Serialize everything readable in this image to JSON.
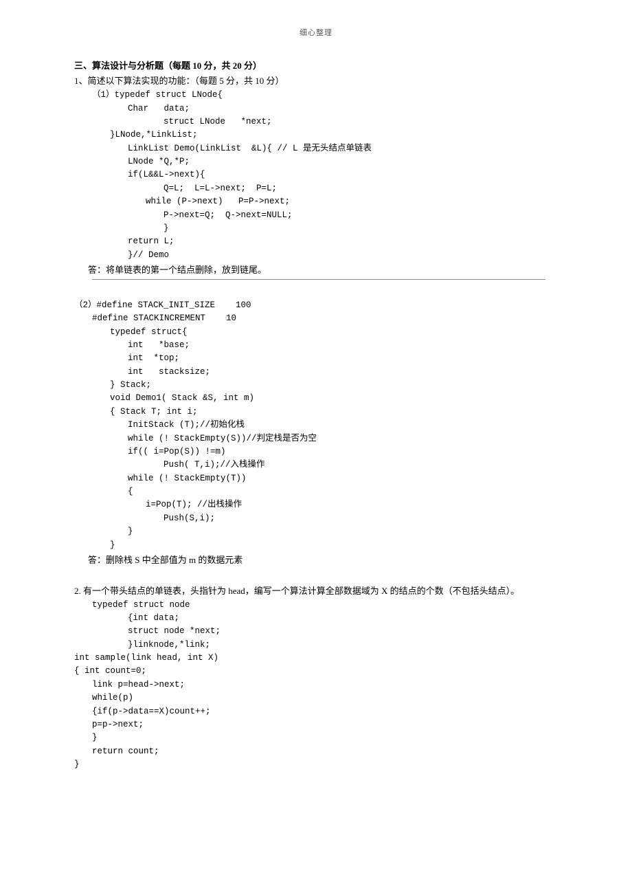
{
  "header": "细心整理",
  "sectionTitle": "三、算法设计与分析题（每题 10 分，共 20 分）",
  "q1": {
    "prompt": "1、简述以下算法实现的功能：（每题 5 分，共 10 分）",
    "sub1label": "（1）typedef struct LNode{",
    "code1": {
      "l1": "Char   data;",
      "l2": "struct LNode   *next;",
      "l3": "}LNode,*LinkList;",
      "l4": "LinkList Demo(LinkList  &L){ // L 是无头结点单链表",
      "l5": "LNode *Q,*P;",
      "l6": "if(L&&L->next){",
      "l7": "Q=L;  L=L->next;  P=L;",
      "l8": "while (P->next)   P=P->next;",
      "l9": "P->next=Q;  Q->next=NULL;",
      "l10": "}",
      "l11": "return L;",
      "l12": "}// Demo"
    },
    "answer1": "答：将单链表的第一个结点删除，放到链尾。",
    "sub2label": "（2）#define STACK_INIT_SIZE    100",
    "code2": {
      "l1": "#define STACKINCREMENT    10",
      "l2": "typedef struct{",
      "l3": "int   *base;",
      "l4": "int  *top;",
      "l5": "int   stacksize;",
      "l6": "} Stack;",
      "l7": "void Demo1( Stack &S, int m)",
      "l8": "{ Stack T; int i;",
      "l9": "InitStack (T);//初始化栈",
      "l10": "while (! StackEmpty(S))//判定栈是否为空",
      "l11": "if(( i=Pop(S)) !=m)",
      "l12": "Push( T,i);//入栈操作",
      "l13": "while (! StackEmpty(T))",
      "l14": "{",
      "l15": "i=Pop(T); //出栈操作",
      "l16": "Push(S,i);",
      "l17": "}",
      "l18": "}"
    },
    "answer2": "答：删除栈 S 中全部值为 m 的数据元素"
  },
  "q2": {
    "prompt": "2. 有一个带头结点的单链表，头指针为 head，编写一个算法计算全部数据域为 X 的结点的个数（不包括头结点）。",
    "code": {
      "l1": "typedef struct node",
      "l2": "{int data;",
      "l3": "struct node *next;",
      "l4": "}linknode,*link;",
      "l5": "int sample(link head, int X)",
      "l6": "{ int count=0;",
      "l7": "link p=head->next;",
      "l8": "while(p)",
      "l9": "{if(p->data==X)count++;",
      "l10": "p=p->next;",
      "l11": "}",
      "l12": "return count;",
      "l13": "}"
    }
  }
}
